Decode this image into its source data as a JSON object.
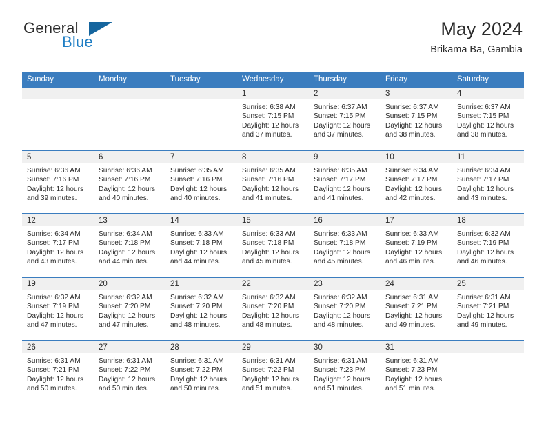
{
  "brand": {
    "line1": "General",
    "line2": "Blue",
    "triangle_color": "#15659e",
    "blue_color": "#1f7ec4"
  },
  "header": {
    "title": "May 2024",
    "subtitle": "Brikama Ba, Gambia"
  },
  "theme": {
    "header_row_bg": "#3b7dbf",
    "daynum_bg": "#f0f0f0",
    "text": "#2b2b2b"
  },
  "calendar": {
    "weekday_headers": [
      "Sunday",
      "Monday",
      "Tuesday",
      "Wednesday",
      "Thursday",
      "Friday",
      "Saturday"
    ],
    "labels": {
      "sunrise": "Sunrise:",
      "sunset": "Sunset:",
      "daylight": "Daylight:"
    },
    "weeks": [
      [
        {
          "day": "",
          "empty": true
        },
        {
          "day": "",
          "empty": true
        },
        {
          "day": "",
          "empty": true
        },
        {
          "day": "1",
          "sunrise": "Sunrise: 6:38 AM",
          "sunset": "Sunset: 7:15 PM",
          "daylight1": "Daylight: 12 hours",
          "daylight2": "and 37 minutes."
        },
        {
          "day": "2",
          "sunrise": "Sunrise: 6:37 AM",
          "sunset": "Sunset: 7:15 PM",
          "daylight1": "Daylight: 12 hours",
          "daylight2": "and 37 minutes."
        },
        {
          "day": "3",
          "sunrise": "Sunrise: 6:37 AM",
          "sunset": "Sunset: 7:15 PM",
          "daylight1": "Daylight: 12 hours",
          "daylight2": "and 38 minutes."
        },
        {
          "day": "4",
          "sunrise": "Sunrise: 6:37 AM",
          "sunset": "Sunset: 7:15 PM",
          "daylight1": "Daylight: 12 hours",
          "daylight2": "and 38 minutes."
        }
      ],
      [
        {
          "day": "5",
          "sunrise": "Sunrise: 6:36 AM",
          "sunset": "Sunset: 7:16 PM",
          "daylight1": "Daylight: 12 hours",
          "daylight2": "and 39 minutes."
        },
        {
          "day": "6",
          "sunrise": "Sunrise: 6:36 AM",
          "sunset": "Sunset: 7:16 PM",
          "daylight1": "Daylight: 12 hours",
          "daylight2": "and 40 minutes."
        },
        {
          "day": "7",
          "sunrise": "Sunrise: 6:35 AM",
          "sunset": "Sunset: 7:16 PM",
          "daylight1": "Daylight: 12 hours",
          "daylight2": "and 40 minutes."
        },
        {
          "day": "8",
          "sunrise": "Sunrise: 6:35 AM",
          "sunset": "Sunset: 7:16 PM",
          "daylight1": "Daylight: 12 hours",
          "daylight2": "and 41 minutes."
        },
        {
          "day": "9",
          "sunrise": "Sunrise: 6:35 AM",
          "sunset": "Sunset: 7:17 PM",
          "daylight1": "Daylight: 12 hours",
          "daylight2": "and 41 minutes."
        },
        {
          "day": "10",
          "sunrise": "Sunrise: 6:34 AM",
          "sunset": "Sunset: 7:17 PM",
          "daylight1": "Daylight: 12 hours",
          "daylight2": "and 42 minutes."
        },
        {
          "day": "11",
          "sunrise": "Sunrise: 6:34 AM",
          "sunset": "Sunset: 7:17 PM",
          "daylight1": "Daylight: 12 hours",
          "daylight2": "and 43 minutes."
        }
      ],
      [
        {
          "day": "12",
          "sunrise": "Sunrise: 6:34 AM",
          "sunset": "Sunset: 7:17 PM",
          "daylight1": "Daylight: 12 hours",
          "daylight2": "and 43 minutes."
        },
        {
          "day": "13",
          "sunrise": "Sunrise: 6:34 AM",
          "sunset": "Sunset: 7:18 PM",
          "daylight1": "Daylight: 12 hours",
          "daylight2": "and 44 minutes."
        },
        {
          "day": "14",
          "sunrise": "Sunrise: 6:33 AM",
          "sunset": "Sunset: 7:18 PM",
          "daylight1": "Daylight: 12 hours",
          "daylight2": "and 44 minutes."
        },
        {
          "day": "15",
          "sunrise": "Sunrise: 6:33 AM",
          "sunset": "Sunset: 7:18 PM",
          "daylight1": "Daylight: 12 hours",
          "daylight2": "and 45 minutes."
        },
        {
          "day": "16",
          "sunrise": "Sunrise: 6:33 AM",
          "sunset": "Sunset: 7:18 PM",
          "daylight1": "Daylight: 12 hours",
          "daylight2": "and 45 minutes."
        },
        {
          "day": "17",
          "sunrise": "Sunrise: 6:33 AM",
          "sunset": "Sunset: 7:19 PM",
          "daylight1": "Daylight: 12 hours",
          "daylight2": "and 46 minutes."
        },
        {
          "day": "18",
          "sunrise": "Sunrise: 6:32 AM",
          "sunset": "Sunset: 7:19 PM",
          "daylight1": "Daylight: 12 hours",
          "daylight2": "and 46 minutes."
        }
      ],
      [
        {
          "day": "19",
          "sunrise": "Sunrise: 6:32 AM",
          "sunset": "Sunset: 7:19 PM",
          "daylight1": "Daylight: 12 hours",
          "daylight2": "and 47 minutes."
        },
        {
          "day": "20",
          "sunrise": "Sunrise: 6:32 AM",
          "sunset": "Sunset: 7:20 PM",
          "daylight1": "Daylight: 12 hours",
          "daylight2": "and 47 minutes."
        },
        {
          "day": "21",
          "sunrise": "Sunrise: 6:32 AM",
          "sunset": "Sunset: 7:20 PM",
          "daylight1": "Daylight: 12 hours",
          "daylight2": "and 48 minutes."
        },
        {
          "day": "22",
          "sunrise": "Sunrise: 6:32 AM",
          "sunset": "Sunset: 7:20 PM",
          "daylight1": "Daylight: 12 hours",
          "daylight2": "and 48 minutes."
        },
        {
          "day": "23",
          "sunrise": "Sunrise: 6:32 AM",
          "sunset": "Sunset: 7:20 PM",
          "daylight1": "Daylight: 12 hours",
          "daylight2": "and 48 minutes."
        },
        {
          "day": "24",
          "sunrise": "Sunrise: 6:31 AM",
          "sunset": "Sunset: 7:21 PM",
          "daylight1": "Daylight: 12 hours",
          "daylight2": "and 49 minutes."
        },
        {
          "day": "25",
          "sunrise": "Sunrise: 6:31 AM",
          "sunset": "Sunset: 7:21 PM",
          "daylight1": "Daylight: 12 hours",
          "daylight2": "and 49 minutes."
        }
      ],
      [
        {
          "day": "26",
          "sunrise": "Sunrise: 6:31 AM",
          "sunset": "Sunset: 7:21 PM",
          "daylight1": "Daylight: 12 hours",
          "daylight2": "and 50 minutes."
        },
        {
          "day": "27",
          "sunrise": "Sunrise: 6:31 AM",
          "sunset": "Sunset: 7:22 PM",
          "daylight1": "Daylight: 12 hours",
          "daylight2": "and 50 minutes."
        },
        {
          "day": "28",
          "sunrise": "Sunrise: 6:31 AM",
          "sunset": "Sunset: 7:22 PM",
          "daylight1": "Daylight: 12 hours",
          "daylight2": "and 50 minutes."
        },
        {
          "day": "29",
          "sunrise": "Sunrise: 6:31 AM",
          "sunset": "Sunset: 7:22 PM",
          "daylight1": "Daylight: 12 hours",
          "daylight2": "and 51 minutes."
        },
        {
          "day": "30",
          "sunrise": "Sunrise: 6:31 AM",
          "sunset": "Sunset: 7:23 PM",
          "daylight1": "Daylight: 12 hours",
          "daylight2": "and 51 minutes."
        },
        {
          "day": "31",
          "sunrise": "Sunrise: 6:31 AM",
          "sunset": "Sunset: 7:23 PM",
          "daylight1": "Daylight: 12 hours",
          "daylight2": "and 51 minutes."
        },
        {
          "day": "",
          "empty": true,
          "blank": true
        }
      ]
    ]
  }
}
